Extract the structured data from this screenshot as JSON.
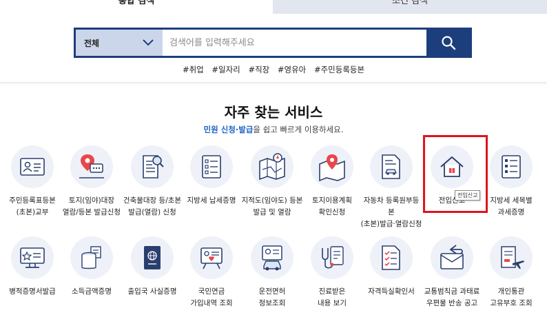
{
  "tabs": {
    "integrated": "통합 검색",
    "conditional": "조건 검색"
  },
  "search": {
    "category": "전체",
    "placeholder": "검색어를 입력해주세요"
  },
  "hashtags": [
    "#취업",
    "#일자리",
    "#직장",
    "#영유아",
    "#주민등록등본"
  ],
  "section": {
    "title": "자주 찾는 서비스",
    "subtitle_highlight": "민원 신청·발급",
    "subtitle_rest": "을 쉽고 빠르게 이용하세요."
  },
  "services": [
    {
      "label": "주민등록표등본\n(초본)교부",
      "icon": "id-card-icon"
    },
    {
      "label": "토지(임야)대장\n열람/등본 발급신청",
      "icon": "map-pin-chat-icon"
    },
    {
      "label": "건축물대장 등/초본\n발급(열람) 신청",
      "icon": "document-search-icon"
    },
    {
      "label": "지방세 납세증명",
      "icon": "checklist-icon"
    },
    {
      "label": "지적도(임야도) 등본\n발급 및 열람",
      "icon": "map-compass-icon"
    },
    {
      "label": "토지이용계획\n확인신청",
      "icon": "map-pin-icon"
    },
    {
      "label": "자동차 등록원부등본\n(초본)발급·열람신청",
      "icon": "car-document-icon"
    },
    {
      "label": "전입신고",
      "icon": "house-icon"
    },
    {
      "label": "지방세 세목별\n과세증명",
      "icon": "tax-list-icon"
    },
    {
      "label": "병적증명서발급",
      "icon": "monitor-star-icon"
    },
    {
      "label": "소득금액증명",
      "icon": "coin-stack-icon"
    },
    {
      "label": "출입국 사실증명",
      "icon": "passport-icon"
    },
    {
      "label": "국민연금\n가입내역 조회",
      "icon": "pension-board-icon"
    },
    {
      "label": "운전면허\n정보조회",
      "icon": "license-car-icon"
    },
    {
      "label": "진료받은\n내용 보기",
      "icon": "stethoscope-icon"
    },
    {
      "label": "자격득실확인서",
      "icon": "check-document-icon"
    },
    {
      "label": "교통범칙금 과태료\n우편물 반송 공고",
      "icon": "return-mail-icon"
    },
    {
      "label": "개인통관\n고유부호 조회",
      "icon": "airplane-ticket-icon"
    }
  ],
  "tooltip": "전입신고",
  "colors": {
    "navy": "#1d3e7c",
    "select_bg": "#ccd6ea",
    "accent_blue": "#1c64c7",
    "highlight_red": "#e0131b",
    "icon_navy": "#2a3f6e",
    "icon_red": "#e8474b"
  }
}
